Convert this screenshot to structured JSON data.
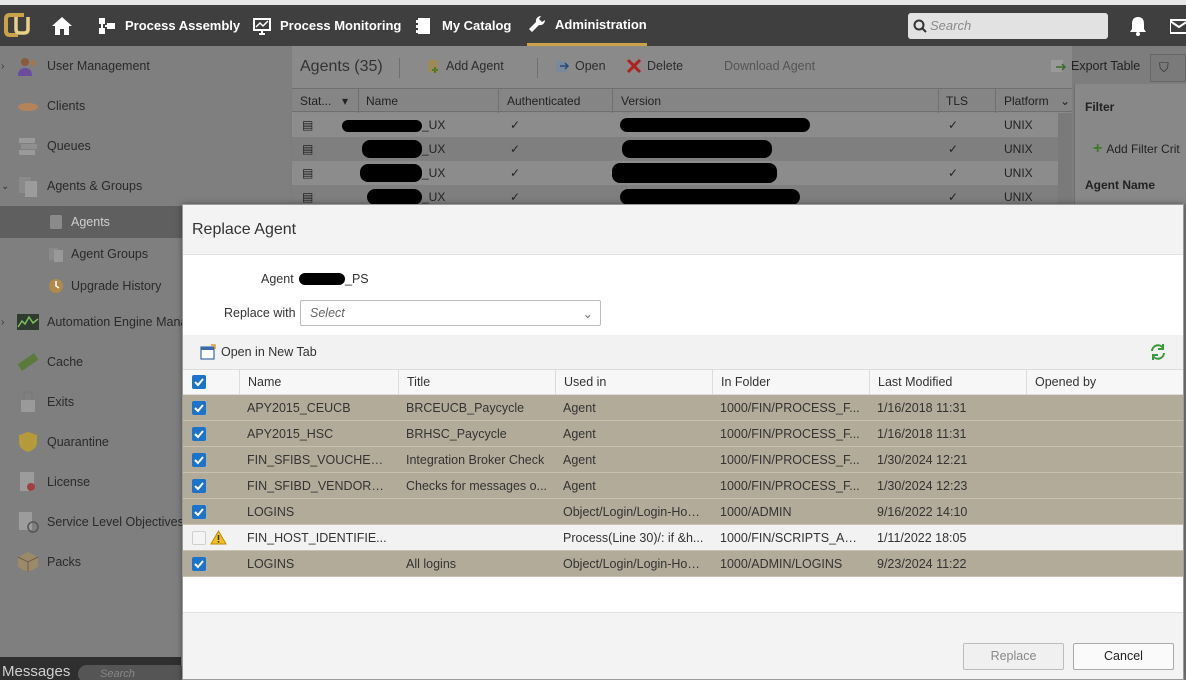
{
  "topnav": {
    "items": [
      {
        "label": "Process Assembly"
      },
      {
        "label": "Process Monitoring"
      },
      {
        "label": "My Catalog"
      },
      {
        "label": "Administration"
      }
    ],
    "search_placeholder": "Search",
    "accent_color": "#c9a24a"
  },
  "sidebar": {
    "items": [
      {
        "label": "User Management",
        "icon": "users-icon"
      },
      {
        "label": "Clients",
        "icon": "clients-icon"
      },
      {
        "label": "Queues",
        "icon": "queues-icon"
      },
      {
        "label": "Agents & Groups",
        "icon": "agents-groups-icon"
      },
      {
        "label": "Agents",
        "icon": "agent-icon"
      },
      {
        "label": "Agent Groups",
        "icon": "agent-groups-icon"
      },
      {
        "label": "Upgrade History",
        "icon": "upgrade-history-icon"
      },
      {
        "label": "Automation Engine Mana",
        "icon": "engine-icon"
      },
      {
        "label": "Cache",
        "icon": "cache-icon"
      },
      {
        "label": "Exits",
        "icon": "exits-icon"
      },
      {
        "label": "Quarantine",
        "icon": "quarantine-icon"
      },
      {
        "label": "License",
        "icon": "license-icon"
      },
      {
        "label": "Service Level Objectives",
        "icon": "slo-icon"
      },
      {
        "label": "Packs",
        "icon": "packs-icon"
      }
    ],
    "messages_label": "Messages",
    "messages_search": "Search"
  },
  "agents_panel": {
    "title": "Agents (35)",
    "toolbar": {
      "add": "Add Agent",
      "open": "Open",
      "delete": "Delete",
      "download": "Download Agent",
      "export": "Export Table"
    },
    "columns": [
      "Stat...",
      "Name",
      "Authenticated",
      "Version",
      "TLS",
      "Platform"
    ],
    "rows": [
      {
        "name": "_UX",
        "authenticated": "✓",
        "tls": "✓",
        "platform": "UNIX"
      },
      {
        "name": "_UX",
        "authenticated": "✓",
        "tls": "✓",
        "platform": "UNIX"
      },
      {
        "name": "_UX",
        "authenticated": "✓",
        "tls": "✓",
        "platform": "UNIX"
      },
      {
        "name": "_UX",
        "authenticated": "✓",
        "tls": "✓",
        "platform": "UNIX"
      }
    ]
  },
  "filter_panel": {
    "title": "Filter",
    "add_filter": "Add Filter Crit",
    "agent_name_label": "Agent Name"
  },
  "dialog": {
    "title": "Replace Agent",
    "agent_label": "Agent",
    "agent_value": "_PS",
    "replace_with_label": "Replace with",
    "select_placeholder": "Select",
    "open_new_tab": "Open in New Tab",
    "columns": [
      "Name",
      "Title",
      "Used in",
      "In Folder",
      "Last Modified",
      "Opened by"
    ],
    "rows": [
      {
        "checked": true,
        "warning": false,
        "name": "APY2015_CEUCB",
        "title": "BRCEUCB_Paycycle",
        "used_in": "Agent",
        "folder": "1000/FIN/PROCESS_F...",
        "modified": "1/16/2018 11:31",
        "opened_by": ""
      },
      {
        "checked": true,
        "warning": false,
        "name": "APY2015_HSC",
        "title": "BRHSC_Paycycle",
        "used_in": "Agent",
        "folder": "1000/FIN/PROCESS_F...",
        "modified": "1/16/2018 11:31",
        "opened_by": ""
      },
      {
        "checked": true,
        "warning": false,
        "name": "FIN_SFIBS_VOUCHER...",
        "title": "Integration Broker Check",
        "used_in": "Agent",
        "folder": "1000/FIN/PROCESS_F...",
        "modified": "1/30/2024 12:21",
        "opened_by": ""
      },
      {
        "checked": true,
        "warning": false,
        "name": "FIN_SFIBD_VENDOR_...",
        "title": "Checks for messages o...",
        "used_in": "Agent",
        "folder": "1000/FIN/PROCESS_F...",
        "modified": "1/30/2024 12:23",
        "opened_by": ""
      },
      {
        "checked": true,
        "warning": false,
        "name": "LOGINS",
        "title": "",
        "used_in": "Object/Login/Login-Host...",
        "folder": "1000/ADMIN",
        "modified": "9/16/2022 14:10",
        "opened_by": ""
      },
      {
        "checked": false,
        "warning": true,
        "name": "FIN_HOST_IDENTIFIE...",
        "title": "",
        "used_in": "Process(Line 30)/: if &h...",
        "folder": "1000/FIN/SCRIPTS_AN...",
        "modified": "1/11/2022 18:05",
        "opened_by": ""
      },
      {
        "checked": true,
        "warning": false,
        "name": "LOGINS",
        "title": "All logins",
        "used_in": "Object/Login/Login-Host...",
        "folder": "1000/ADMIN/LOGINS",
        "modified": "9/23/2024 11:22",
        "opened_by": ""
      }
    ],
    "replace_button": "Replace",
    "cancel_button": "Cancel",
    "checked_color": "#1d72c9",
    "selected_row_color": "#b3ab99"
  }
}
